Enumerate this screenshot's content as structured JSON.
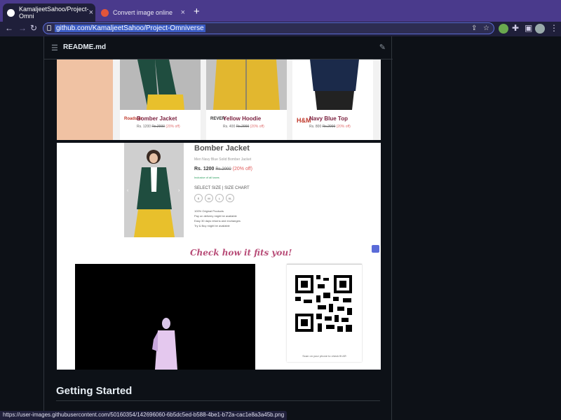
{
  "browser": {
    "tabs": [
      {
        "title": "KamaljeetSahoo/Project-Omni",
        "active": true,
        "close": "×"
      },
      {
        "title": "Convert image online",
        "active": false,
        "close": "×"
      }
    ],
    "new_tab": "+",
    "url": "github.com/KamaljeetSahoo/Project-Omniverse",
    "status_url": "https://user-images.githubusercontent.com/50160354/142696060-6b5dc5ed-b588-4be1-b72a-cac1e8a3a45b.png"
  },
  "readme": {
    "file_title": "README.md",
    "section_heading": "Getting Started"
  },
  "cards": [
    {
      "brand": "Roadster",
      "name": "Bomber Jacket",
      "price": "Rs. 1200",
      "old_price": "Rs.2000",
      "off": "(20% off)"
    },
    {
      "brand": "REVER",
      "name": "Yellow Hoodie",
      "price": "Rs. 400",
      "old_price": "Rs.2000",
      "off": "(20% off)"
    },
    {
      "brand": "H&M",
      "name": "Navy Blue Top",
      "price": "Rs. 800",
      "old_price": "Rs.2000",
      "off": "(20% off)"
    }
  ],
  "product": {
    "title": "Bomber Jacket",
    "subtitle": "Men Navy Blue Solid Bomber Jacket",
    "price": "Rs. 1200",
    "old_price": "Rs.2000",
    "off": "(20% off)",
    "tax_note": "Inclusive of all taxes",
    "select_size": "SELECT SIZE |  SIZE CHART",
    "sizes": [
      "S",
      "M",
      "L",
      "XL"
    ],
    "features": [
      "100% Original Products",
      "Pay on delivery might be available",
      "Easy 30 days returns and exchanges",
      "Try & Buy might be available"
    ],
    "check_fit": "Check how it fits you!",
    "qr_caption": "Scan on your phone to check fit AR"
  },
  "colors": {
    "tab_bar": "#4a3a8c",
    "accent": "#5a6bd8",
    "page_bg": "#0d1117"
  }
}
